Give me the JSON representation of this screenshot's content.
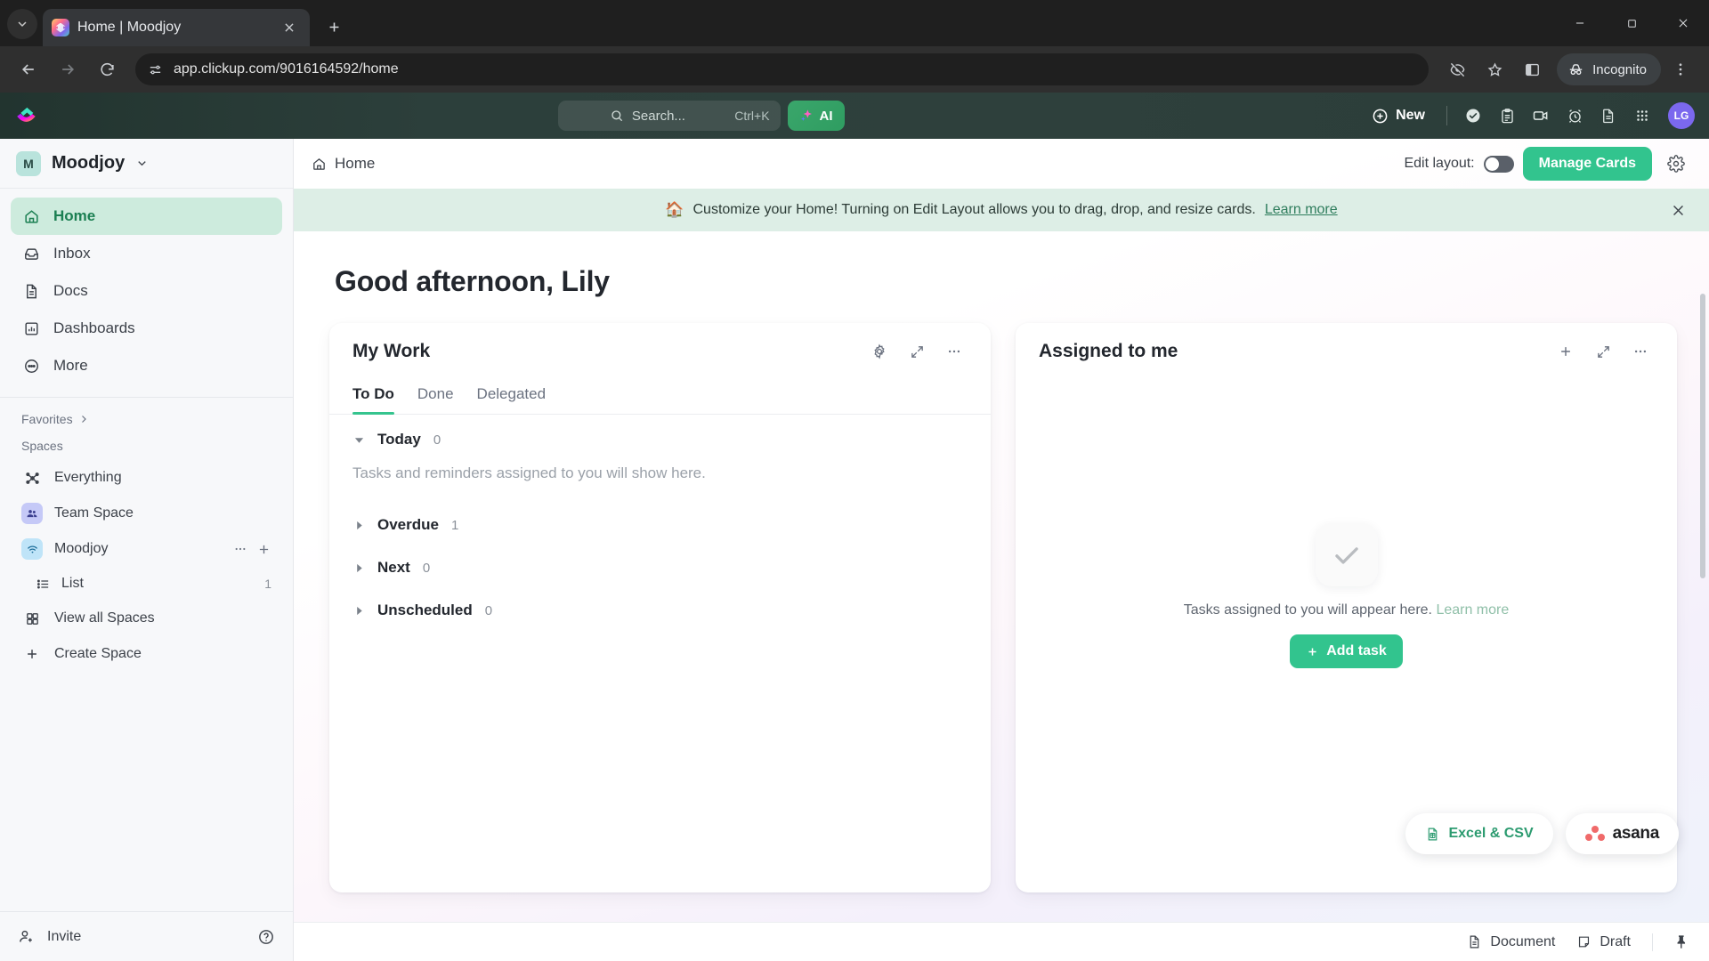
{
  "browser": {
    "tab": {
      "title": "Home | Moodjoy",
      "favicon": "clickup-favicon",
      "close": "close-icon"
    },
    "new_tab_label": "+",
    "url": "app.clickup.com/9016164592/home",
    "profile_label": "Incognito",
    "window": {
      "minimize": "minimize-icon",
      "maximize": "maximize-icon",
      "close": "close-icon"
    }
  },
  "topbar": {
    "search": {
      "placeholder": "Search...",
      "shortcut": "Ctrl+K"
    },
    "ai_label": "AI",
    "new_label": "New",
    "avatar_initials": "LG",
    "icons": [
      "check-circle-icon",
      "clipboard-icon",
      "video-icon",
      "alarm-clock-icon",
      "document-icon",
      "apps-grid-icon"
    ]
  },
  "sidebar": {
    "workspace": {
      "badge": "M",
      "name": "Moodjoy",
      "chevron": "chevron-down-icon"
    },
    "nav": [
      {
        "label": "Home",
        "icon": "home-icon",
        "active": true
      },
      {
        "label": "Inbox",
        "icon": "inbox-icon",
        "active": false
      },
      {
        "label": "Docs",
        "icon": "docs-icon",
        "active": false
      },
      {
        "label": "Dashboards",
        "icon": "dashboards-icon",
        "active": false
      },
      {
        "label": "More",
        "icon": "more-icon",
        "active": false
      }
    ],
    "favorites_label": "Favorites",
    "spaces_label": "Spaces",
    "spaces": [
      {
        "label": "Everything",
        "icon": "everything-icon"
      },
      {
        "label": "Team Space",
        "icon": "team-space-icon"
      },
      {
        "label": "Moodjoy",
        "icon": "wifi-space-icon"
      }
    ],
    "list": {
      "label": "List",
      "count": "1",
      "icon": "list-icon"
    },
    "view_all_spaces": "View all Spaces",
    "create_space": "Create Space",
    "invite": "Invite",
    "help": "help-icon"
  },
  "main": {
    "breadcrumb": "Home",
    "edit_layout_label": "Edit layout:",
    "edit_layout_on": false,
    "manage_cards_label": "Manage Cards",
    "settings_icon": "gear-icon",
    "banner": {
      "emoji": "🏠",
      "text": "Customize your Home! Turning on Edit Layout allows you to drag, drop, and resize cards.",
      "link": "Learn more",
      "close": "close-icon"
    },
    "greeting": "Good afternoon, Lily"
  },
  "my_work_card": {
    "title": "My Work",
    "actions": [
      "gear-icon",
      "expand-icon",
      "more-icon"
    ],
    "tabs": [
      {
        "label": "To Do",
        "active": true
      },
      {
        "label": "Done",
        "active": false
      },
      {
        "label": "Delegated",
        "active": false
      }
    ],
    "groups": [
      {
        "name": "Today",
        "count": "0",
        "expanded": true,
        "empty_text": "Tasks and reminders assigned to you will show here."
      },
      {
        "name": "Overdue",
        "count": "1",
        "expanded": false
      },
      {
        "name": "Next",
        "count": "0",
        "expanded": false
      },
      {
        "name": "Unscheduled",
        "count": "0",
        "expanded": false
      }
    ]
  },
  "assigned_card": {
    "title": "Assigned to me",
    "actions": [
      "plus-icon",
      "expand-icon",
      "more-icon"
    ],
    "empty_text": "Tasks assigned to you will appear here.",
    "empty_link": "Learn more",
    "add_task_label": "Add task"
  },
  "floaters": [
    {
      "label": "Excel & CSV",
      "icon": "excel-icon"
    },
    {
      "label": "asana",
      "icon": "asana-icon"
    }
  ],
  "statusbar": {
    "document_label": "Document",
    "draft_label": "Draft",
    "pin_icon": "pin-icon"
  },
  "colors": {
    "accent_green": "#32c48e",
    "topbar_bg": "#2c3f3b",
    "banner_bg": "#ddeee6",
    "sidebar_bg": "#f7f8fa",
    "avatar_purple": "#7b68ee",
    "active_nav_bg": "#cdebdd"
  }
}
